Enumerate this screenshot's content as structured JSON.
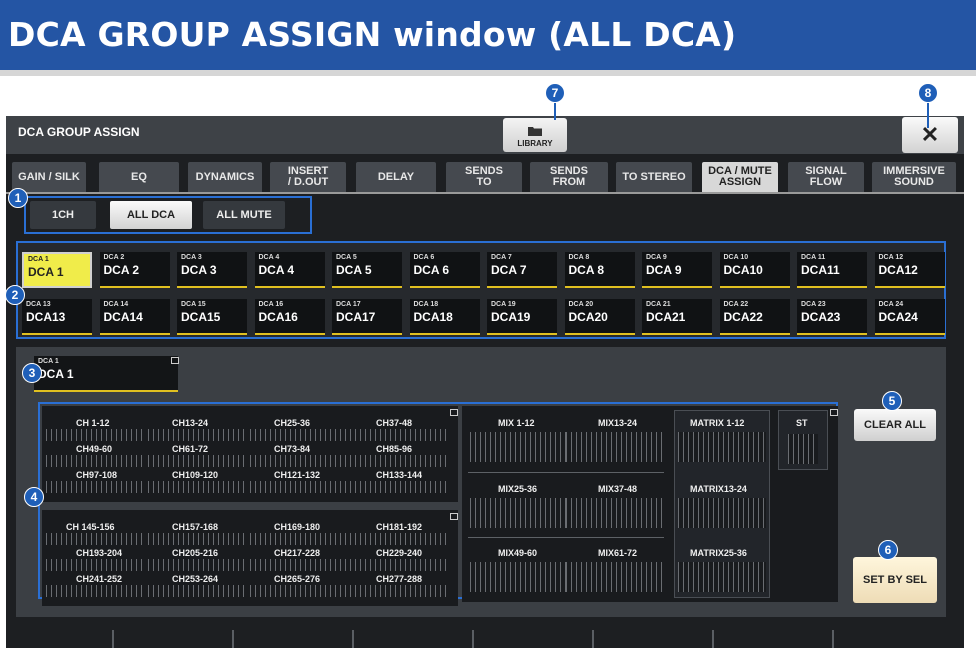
{
  "heading": "DCA GROUP ASSIGN window (ALL DCA)",
  "window": {
    "title": "DCA GROUP ASSIGN",
    "library_label": "LIBRARY",
    "close_glyph": "✕"
  },
  "tabs": [
    {
      "label": "GAIN / SILK",
      "active": false
    },
    {
      "label": "EQ",
      "active": false
    },
    {
      "label": "DYNAMICS",
      "active": false
    },
    {
      "label": "INSERT\n/ D.OUT",
      "active": false
    },
    {
      "label": "DELAY",
      "active": false
    },
    {
      "label": "SENDS\nTO",
      "active": false
    },
    {
      "label": "SENDS\nFROM",
      "active": false
    },
    {
      "label": "TO STEREO",
      "active": false
    },
    {
      "label": "DCA / MUTE\nASSIGN",
      "active": true
    },
    {
      "label": "SIGNAL\nFLOW",
      "active": false
    },
    {
      "label": "IMMERSIVE\nSOUND",
      "active": false
    }
  ],
  "subtabs": [
    {
      "label": "1CH",
      "active": false
    },
    {
      "label": "ALL DCA",
      "active": true
    },
    {
      "label": "ALL MUTE",
      "active": false
    }
  ],
  "dca_row1": [
    {
      "small": "DCA 1",
      "big": "DCA 1",
      "selected": true
    },
    {
      "small": "DCA 2",
      "big": "DCA 2"
    },
    {
      "small": "DCA 3",
      "big": "DCA 3"
    },
    {
      "small": "DCA 4",
      "big": "DCA 4"
    },
    {
      "small": "DCA 5",
      "big": "DCA 5"
    },
    {
      "small": "DCA 6",
      "big": "DCA 6"
    },
    {
      "small": "DCA 7",
      "big": "DCA 7"
    },
    {
      "small": "DCA 8",
      "big": "DCA 8"
    },
    {
      "small": "DCA 9",
      "big": "DCA 9"
    },
    {
      "small": "DCA 10",
      "big": "DCA10"
    },
    {
      "small": "DCA 11",
      "big": "DCA11"
    },
    {
      "small": "DCA 12",
      "big": "DCA12"
    }
  ],
  "dca_row2": [
    {
      "small": "DCA 13",
      "big": "DCA13"
    },
    {
      "small": "DCA 14",
      "big": "DCA14"
    },
    {
      "small": "DCA 15",
      "big": "DCA15"
    },
    {
      "small": "DCA 16",
      "big": "DCA16"
    },
    {
      "small": "DCA 17",
      "big": "DCA17"
    },
    {
      "small": "DCA 18",
      "big": "DCA18"
    },
    {
      "small": "DCA 19",
      "big": "DCA19"
    },
    {
      "small": "DCA 20",
      "big": "DCA20"
    },
    {
      "small": "DCA 21",
      "big": "DCA21"
    },
    {
      "small": "DCA 22",
      "big": "DCA22"
    },
    {
      "small": "DCA 23",
      "big": "DCA23"
    },
    {
      "small": "DCA 24",
      "big": "DCA24"
    }
  ],
  "selected_dca": {
    "small": "DCA 1",
    "big": "DCA 1"
  },
  "channel_block_1": [
    "CH 1-12",
    "CH13-24",
    "CH25-36",
    "CH37-48",
    "CH49-60",
    "CH61-72",
    "CH73-84",
    "CH85-96",
    "CH97-108",
    "CH109-120",
    "CH121-132",
    "CH133-144"
  ],
  "channel_block_2": [
    "CH 145-156",
    "CH157-168",
    "CH169-180",
    "CH181-192",
    "CH193-204",
    "CH205-216",
    "CH217-228",
    "CH229-240",
    "CH241-252",
    "CH253-264",
    "CH265-276",
    "CH277-288"
  ],
  "mix_labels": [
    "MIX 1-12",
    "MIX13-24",
    "MIX25-36",
    "MIX37-48",
    "MIX49-60",
    "MIX61-72"
  ],
  "matrix_labels": [
    "MATRIX 1-12",
    "MATRIX13-24",
    "MATRIX25-36"
  ],
  "st_label": "ST",
  "clear_all_label": "CLEAR ALL",
  "set_by_sel_label": "SET BY SEL",
  "callouts": [
    "1",
    "2",
    "3",
    "4",
    "5",
    "6",
    "7",
    "8"
  ],
  "colors": {
    "heading_bg": "#2455a4",
    "callout": "#1f5fb8",
    "selected_dca": "#f0ec4a",
    "dca_underline": "#e0c020"
  }
}
